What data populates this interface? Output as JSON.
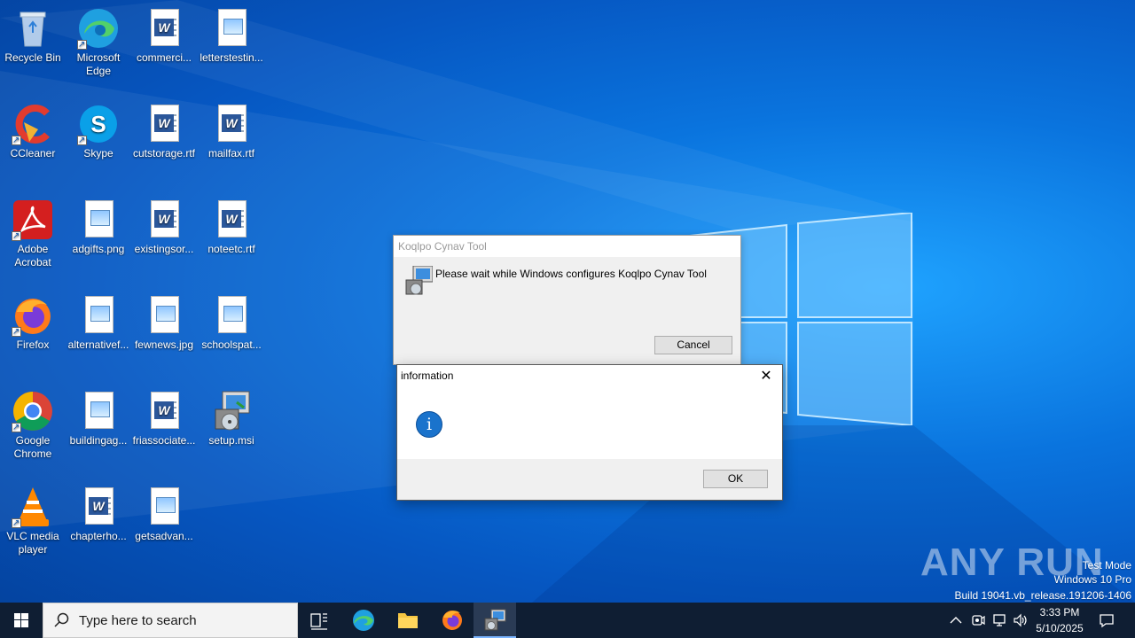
{
  "desktop": {
    "icons": [
      {
        "label": "Recycle Bin",
        "type": "recycle-bin"
      },
      {
        "label": "Microsoft Edge",
        "type": "edge"
      },
      {
        "label": "commerci...",
        "type": "word"
      },
      {
        "label": "letterstestin...",
        "type": "image"
      },
      {
        "label": "CCleaner",
        "type": "ccleaner"
      },
      {
        "label": "Skype",
        "type": "skype"
      },
      {
        "label": "cutstorage.rtf",
        "type": "word"
      },
      {
        "label": "mailfax.rtf",
        "type": "word"
      },
      {
        "label": "Adobe Acrobat",
        "type": "acrobat"
      },
      {
        "label": "adgifts.png",
        "type": "image"
      },
      {
        "label": "existingsor...",
        "type": "word"
      },
      {
        "label": "noteetc.rtf",
        "type": "word"
      },
      {
        "label": "Firefox",
        "type": "firefox"
      },
      {
        "label": "alternativef...",
        "type": "image"
      },
      {
        "label": "fewnews.jpg",
        "type": "image"
      },
      {
        "label": "schoolspat...",
        "type": "image"
      },
      {
        "label": "Google Chrome",
        "type": "chrome"
      },
      {
        "label": "buildingag...",
        "type": "image"
      },
      {
        "label": "friassociate...",
        "type": "word"
      },
      {
        "label": "setup.msi",
        "type": "msi"
      },
      {
        "label": "VLC media player",
        "type": "vlc"
      },
      {
        "label": "chapterho...",
        "type": "word"
      },
      {
        "label": "getsadvan...",
        "type": "image"
      }
    ]
  },
  "installer_dialog": {
    "title": "Koqlpo Cynav Tool",
    "message": "Please wait while Windows configures Koqlpo Cynav Tool",
    "cancel_label": "Cancel"
  },
  "info_dialog": {
    "title": "information",
    "icon": "info-icon",
    "close_glyph": "✕",
    "ok_label": "OK"
  },
  "watermark": {
    "brand": "ANY RUN",
    "line1": "Test Mode",
    "line2": "Windows 10 Pro",
    "line3": "Build 19041.vb_release.191206-1406"
  },
  "taskbar": {
    "search_placeholder": "Type here to search",
    "time": "3:33 PM",
    "date": "5/10/2025",
    "pinned": [
      "task-view",
      "edge",
      "file-explorer",
      "firefox",
      "installer"
    ]
  },
  "colors": {
    "accent": "#0a74de",
    "taskbar": "#0f1e33",
    "info_blue": "#1a73cc"
  }
}
